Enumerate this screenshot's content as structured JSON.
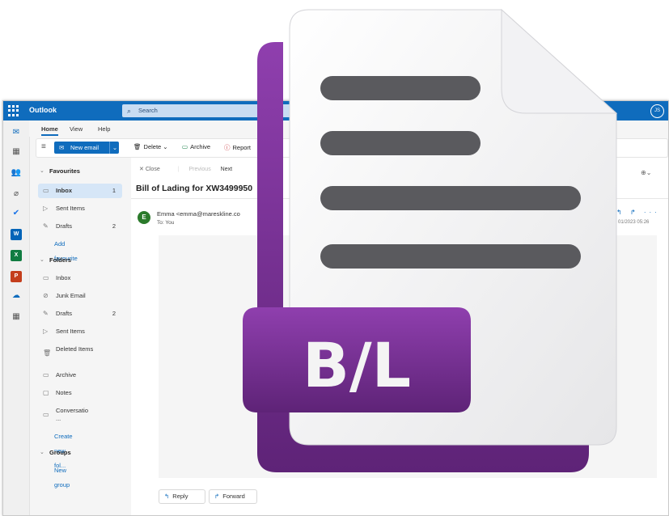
{
  "app": {
    "title": "Outlook",
    "user_initials": "JS"
  },
  "search": {
    "placeholder": "Search"
  },
  "ribbon_tabs": [
    "Home",
    "View",
    "Help"
  ],
  "toolbar": {
    "new_email": "New email",
    "delete": "Delete",
    "archive": "Archive",
    "report": "Report"
  },
  "folders": {
    "favourites_header": "Favourites",
    "favourites": [
      {
        "label": "Inbox",
        "count": "1"
      },
      {
        "label": "Sent Items",
        "count": ""
      },
      {
        "label": "Drafts",
        "count": "2"
      }
    ],
    "add_favourite": "Add favourite",
    "folders_header": "Folders",
    "list": [
      {
        "label": "Inbox",
        "count": ""
      },
      {
        "label": "Junk Email",
        "count": ""
      },
      {
        "label": "Drafts",
        "count": "2"
      },
      {
        "label": "Sent Items",
        "count": ""
      },
      {
        "label": "Deleted Items",
        "count": ""
      },
      {
        "label": "Archive",
        "count": ""
      },
      {
        "label": "Notes",
        "count": ""
      },
      {
        "label": "Conversatio\n...",
        "count": ""
      }
    ],
    "create_new_folder": "Create new fol...",
    "groups_header": "Groups",
    "new_group": "New group"
  },
  "reading": {
    "close": "Close",
    "previous": "Previous",
    "next": "Next",
    "subject": "Bill of Lading for XW3499950",
    "sender_initial": "E",
    "sender": "Emma <emma@mareskline.co",
    "to": "To: You",
    "date": "01/2023 05:26",
    "reply": "Reply",
    "forward": "Forward"
  },
  "overlay_icon": {
    "name": "bl-document-icon",
    "badge_text": "B/L",
    "color": "#7a2f94"
  }
}
